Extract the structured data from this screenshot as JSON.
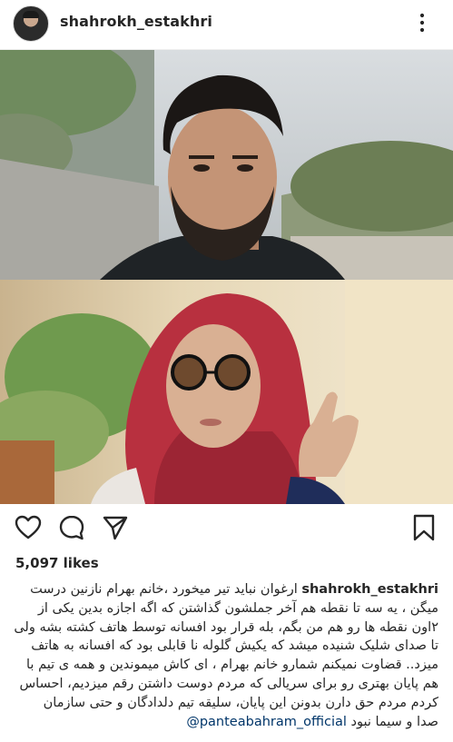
{
  "header": {
    "username": "shahrokh_estakhri",
    "avatar_icon": "profile-avatar",
    "more_icon": "vertical-ellipsis-icon"
  },
  "post": {
    "image_description_icons": [
      "man-portrait",
      "woman-red-hijab-portrait"
    ]
  },
  "actions": {
    "like_icon": "heart-icon",
    "comment_icon": "comment-icon",
    "share_icon": "paper-plane-icon",
    "save_icon": "bookmark-icon"
  },
  "likes": "5,097 likes",
  "caption": {
    "username": "shahrokh_estakhri",
    "line1": "ارغوان نباید تیر میخورد ،خانم بهرام نازنین درست",
    "line2": "میگن ، یه سه تا نقطه هم آخر جملشون گذاشتن که اگه اجازه بدین یکی از",
    "line3": "۲اون نقطه ها رو هم من بگم، بله قرار بود افسانه توسط هاتف کشته بشه ولی",
    "line4": "تا صدای شلیک شنیده میشد که یکیش گلوله نا قابلی بود که افسانه به هاتف",
    "line5": "میزد.. قضاوت نمیکنم شمارو خانم بهرام ، ای کاش میموندین و همه ی تیم با",
    "line6": "هم پایان بهتری رو برای سریالی که مردم دوست داشتن رقم میزدیم، احساس",
    "line7": "کردم مردم حق دارن بدونن این پایان، سلیقه تیم دلدادگان و حتی سازمان",
    "line8_text": "صدا و سیما نبود",
    "mention": "@panteabahram_official"
  }
}
